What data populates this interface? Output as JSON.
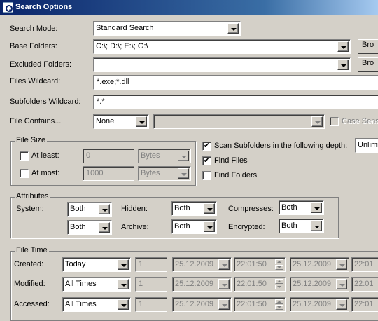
{
  "window": {
    "title": "Search Options"
  },
  "search_mode": {
    "label": "Search Mode:",
    "value": "Standard Search"
  },
  "base_folders": {
    "label": "Base Folders:",
    "value": "C:\\; D:\\; E:\\; G:\\",
    "browse_label": "Bro"
  },
  "excluded_folders": {
    "label": "Excluded Folders:",
    "value": "",
    "browse_label": "Bro"
  },
  "files_wildcard": {
    "label": "Files Wildcard:",
    "value": "*.exe;*.dll"
  },
  "subfolders_wildcard": {
    "label": "Subfolders Wildcard:",
    "value": "*.*"
  },
  "file_contains": {
    "label": "File Contains...",
    "mode": "None",
    "text": "",
    "case_label": "Case Sensi"
  },
  "file_size": {
    "title": "File Size",
    "at_least": {
      "label": "At least:",
      "value": "0",
      "unit": "Bytes",
      "checked": ""
    },
    "at_most": {
      "label": "At most:",
      "value": "1000",
      "unit": "Bytes",
      "checked": ""
    }
  },
  "scan_options": {
    "scan_subfolders": {
      "label": "Scan Subfolders in the following depth:",
      "checked": "✔",
      "depth": "Unlimi"
    },
    "find_files": {
      "label": "Find Files",
      "checked": "✔"
    },
    "find_folders": {
      "label": "Find Folders",
      "checked": ""
    }
  },
  "attributes": {
    "title": "Attributes",
    "system": {
      "label": "System:",
      "value": "Both"
    },
    "hidden": {
      "label": "Hidden:",
      "value": "Both"
    },
    "compressed": {
      "label": "Compresses:",
      "value": "Both"
    },
    "unlabeled": {
      "value": "Both"
    },
    "archive": {
      "label": "Archive:",
      "value": "Both"
    },
    "encrypted": {
      "label": "Encrypted:",
      "value": "Both"
    }
  },
  "file_time": {
    "title": "File Time",
    "rows": [
      {
        "label": "Created:",
        "mode": "Today",
        "count": "1",
        "date1": "25.12.2009",
        "time1": "22:01:50",
        "date2": "25.12.2009",
        "time2": "22:01"
      },
      {
        "label": "Modified:",
        "mode": "All Times",
        "count": "1",
        "date1": "25.12.2009",
        "time1": "22:01:50",
        "date2": "25.12.2009",
        "time2": "22:01"
      },
      {
        "label": "Accessed:",
        "mode": "All Times",
        "count": "1",
        "date1": "25.12.2009",
        "time1": "22:01:50",
        "date2": "25.12.2009",
        "time2": "22:01"
      }
    ]
  },
  "colors": {
    "title_bar_start": "#0a246a",
    "title_bar_end": "#a6caf0",
    "face": "#d4d0c8",
    "disabled_text": "#808080"
  }
}
